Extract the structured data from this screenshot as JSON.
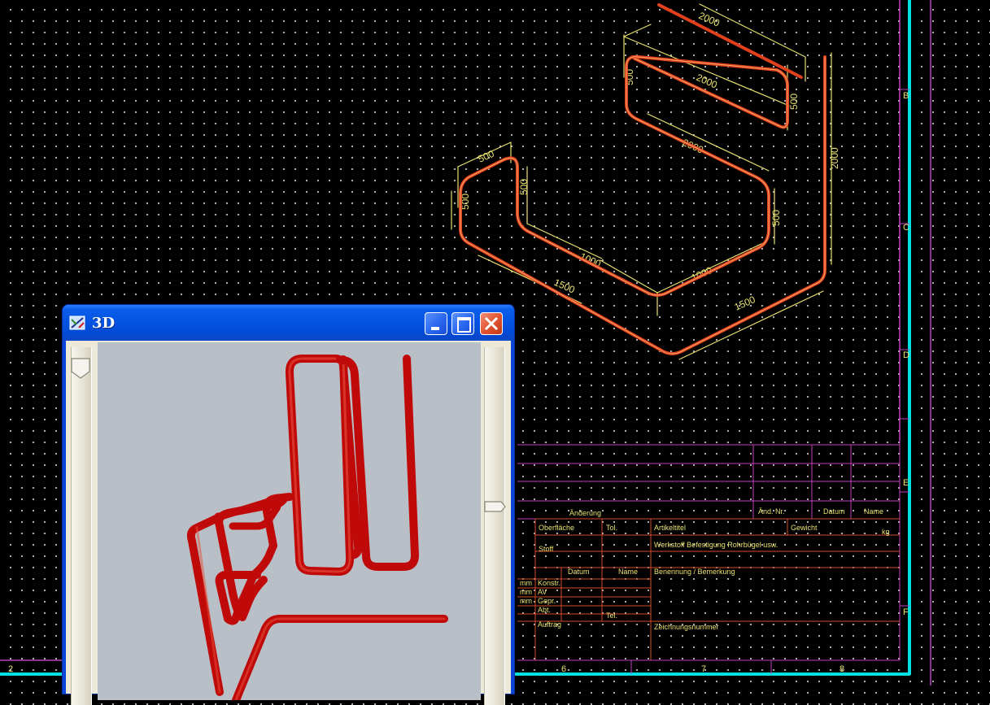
{
  "drawing": {
    "dimensions": [
      "2000",
      "2000",
      "2000",
      "500",
      "500",
      "500",
      "500",
      "500",
      "500",
      "1000",
      "1000",
      "1500",
      "1500",
      "2000"
    ],
    "border_labels_right": [
      "B",
      "C",
      "D",
      "E",
      "F"
    ],
    "border_labels_bottom": [
      "2",
      "6",
      "7",
      "8"
    ]
  },
  "title_block": {
    "aenderung": "Änderung",
    "aend_nr": "Änd. Nr.",
    "datum": "Datum",
    "name": "Name",
    "oberflaeche": "Oberfläche",
    "toleranz": "Tol.",
    "artikeltitel": "Artikeltitel",
    "gewicht": "Gewicht",
    "unit_kg": "kg",
    "stoff": "Stoff",
    "artikeltext": "Werkstoff Befestigung Rohrbügel usw.",
    "datum2": "Datum",
    "name2": "Name",
    "benennung": "Benennung / Bemerkung",
    "mm1": "mm",
    "mm2": "mm",
    "mm3": "mm",
    "konstr": "Konstr.",
    "av": "AV",
    "gepr": "Gepr.",
    "abt": "Abt.",
    "auftrag": "Auftrag",
    "tel": "Tel.",
    "zeichnungsnummer": "Zeichnungsnummer"
  },
  "window_3d": {
    "title": "3D",
    "icon": "3d-view-icon",
    "buttons": [
      "minimize-icon",
      "maximize-icon",
      "close-icon"
    ]
  },
  "colors": {
    "pipe_cad": "#e0401c",
    "dimension": "#e8e070",
    "frame_cyan": "#00e0e0",
    "frame_magenta": "#c040c0",
    "pipe_3d": "#c00a0a",
    "viewport_bg": "#b8bfc6",
    "titlebar": "#0553e2"
  }
}
